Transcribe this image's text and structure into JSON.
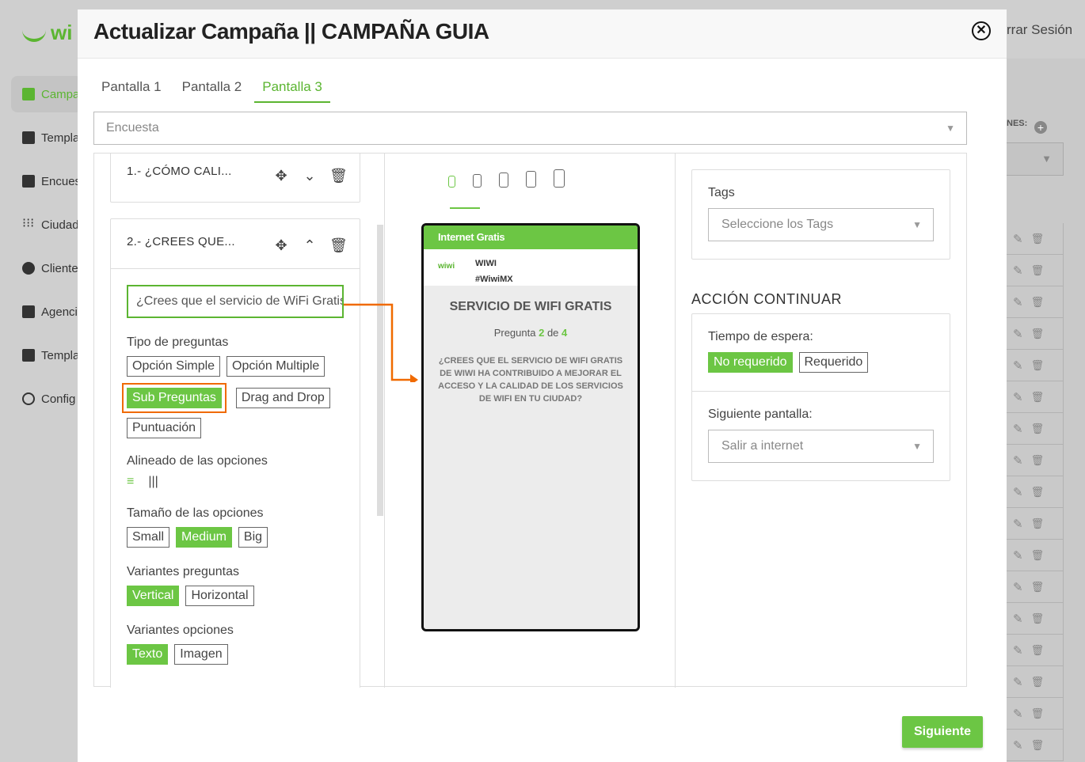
{
  "background": {
    "logo_text": "wi",
    "logout_label": "rrar Sesión",
    "nav": [
      {
        "label": "Campa",
        "icon": "megaphone-icon",
        "active": true
      },
      {
        "label": "Templa",
        "icon": "template-icon",
        "active": false
      },
      {
        "label": "Encues",
        "icon": "clipboard-icon",
        "active": false
      },
      {
        "label": "Ciudad",
        "icon": "grid-dots-icon",
        "active": false
      },
      {
        "label": "Cliente",
        "icon": "users-icon",
        "active": false
      },
      {
        "label": "Agenci",
        "icon": "building-icon",
        "active": false
      },
      {
        "label": "Templa",
        "icon": "template-icon",
        "active": false
      },
      {
        "label": "Config",
        "icon": "gear-icon",
        "active": false
      }
    ],
    "right_header": "NES:",
    "row_count": 17
  },
  "modal": {
    "title": "Actualizar Campaña || CAMPAÑA GUIA",
    "tabs": [
      "Pantalla 1",
      "Pantalla 2",
      "Pantalla 3"
    ],
    "active_tab": 2,
    "type_select": "Encuesta",
    "questions": [
      {
        "title": "1.- ¿CÓMO CALI...",
        "expanded": false
      },
      {
        "title": "2.- ¿CREES QUE...",
        "expanded": true
      }
    ],
    "editor": {
      "question_text": "¿Crees que el servicio de WiFi Gratis",
      "tipo_label": "Tipo de preguntas",
      "tipo_options": [
        "Opción Simple",
        "Opción Multiple",
        "Sub Preguntas",
        "Drag and Drop",
        "Puntuación"
      ],
      "tipo_selected": "Sub Preguntas",
      "alineado_label": "Alineado de las opciones",
      "tamano_label": "Tamaño de las opciones",
      "tamano_options": [
        "Small",
        "Medium",
        "Big"
      ],
      "tamano_selected": "Medium",
      "variantes_preg_label": "Variantes preguntas",
      "variantes_preg_options": [
        "Vertical",
        "Horizontal"
      ],
      "variantes_preg_selected": "Vertical",
      "variantes_opc_label": "Variantes opciones",
      "variantes_opc_options": [
        "Texto",
        "Imagen"
      ],
      "variantes_opc_selected": "Texto"
    },
    "preview": {
      "bar_text": "Internet Gratis",
      "logo_text": "wiwi",
      "brand_name": "WIWI",
      "brand_tag": "#WiwiMX",
      "title": "SERVICIO DE WIFI GRATIS",
      "count_prefix": "Pregunta",
      "count_current": "2",
      "count_mid": "de",
      "count_total": "4",
      "question": "¿CREES QUE EL SERVICIO DE WIFI GRATIS DE WIWI HA CONTRIBUIDO A MEJORAR EL ACCESO Y LA CALIDAD DE LOS SERVICIOS DE WIFI EN TU CIUDAD?"
    },
    "settings": {
      "tags_label": "Tags",
      "tags_placeholder": "Seleccione los Tags",
      "accion_title": "ACCIÓN CONTINUAR",
      "tiempo_label": "Tiempo de espera:",
      "tiempo_options": [
        "No requerido",
        "Requerido"
      ],
      "tiempo_selected": "No requerido",
      "siguiente_label": "Siguiente pantalla:",
      "siguiente_value": "Salir a internet"
    },
    "next_button": "Siguiente"
  },
  "colors": {
    "accent": "#6cc644",
    "highlight": "#f06a00"
  }
}
